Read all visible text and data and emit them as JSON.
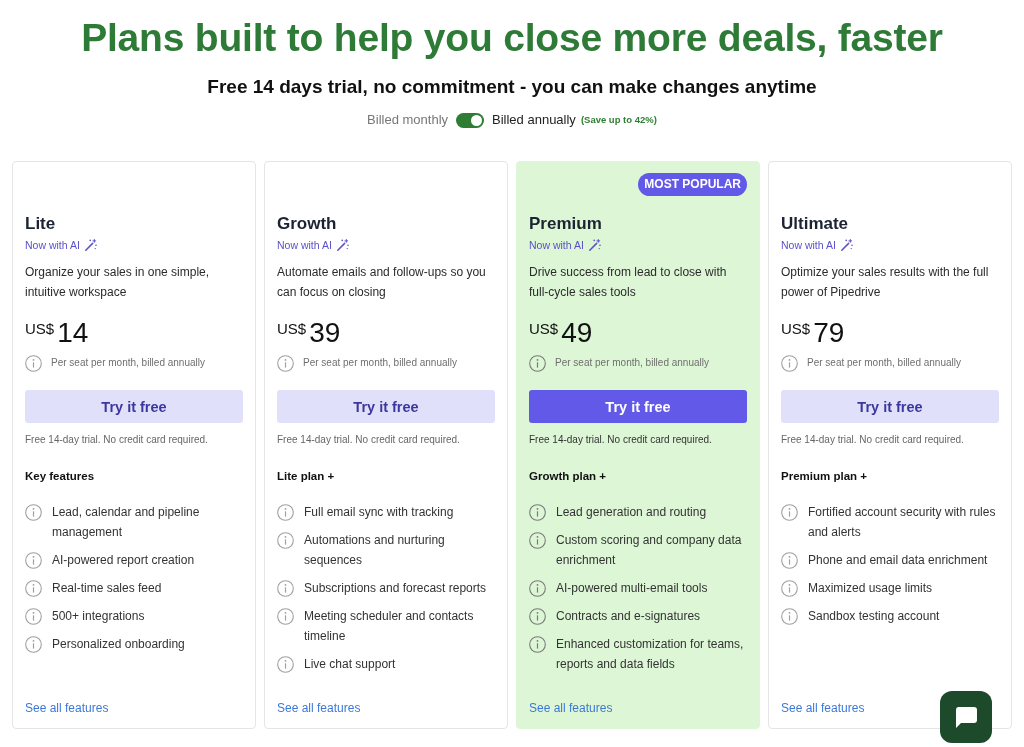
{
  "heading": "Plans built to help you close more deals, faster",
  "subheading": "Free 14 days trial, no commitment - you can make changes anytime",
  "billing_toggle": {
    "left_label": "Billed monthly",
    "right_label": "Billed annually",
    "on": true,
    "savings": "(Save up to 42%)"
  },
  "plans": [
    {
      "name": "Lite",
      "highlighted": false,
      "ai_label": "Now with AI",
      "description": "Organize your sales in one simple, intuitive workspace",
      "currency": "US$",
      "price": "14",
      "price_note": "Per seat per month, billed annually",
      "button_label": "Try it free",
      "trial_note": "Free 14-day trial. No credit card required.",
      "features_heading": "Key features",
      "features": [
        "Lead, calendar and pipeline management",
        "AI-powered report creation",
        "Real-time sales feed",
        "500+ integrations",
        "Personalized onboarding"
      ],
      "link_label": "See all features"
    },
    {
      "name": "Growth",
      "highlighted": false,
      "ai_label": "Now with AI",
      "description": "Automate emails and follow-ups so you can focus on closing",
      "currency": "US$",
      "price": "39",
      "price_note": "Per seat per month, billed annually",
      "button_label": "Try it free",
      "trial_note": "Free 14-day trial. No credit card required.",
      "features_heading": "Lite plan +",
      "features": [
        "Full email sync with tracking",
        "Automations and nurturing sequences",
        "Subscriptions and forecast reports",
        "Meeting scheduler and contacts timeline",
        "Live chat support"
      ],
      "link_label": "See all features"
    },
    {
      "name": "Premium",
      "highlighted": true,
      "badge": "MOST POPULAR",
      "ai_label": "Now with AI",
      "description": "Drive success from lead to close with full-cycle sales tools",
      "currency": "US$",
      "price": "49",
      "price_note": "Per seat per month, billed annually",
      "button_label": "Try it free",
      "trial_note": "Free 14-day trial. No credit card required.",
      "features_heading": "Growth plan +",
      "features": [
        "Lead generation and routing",
        "Custom scoring and company data enrichment",
        "AI-powered multi-email tools",
        "Contracts and e-signatures",
        "Enhanced customization for teams, reports and data fields"
      ],
      "link_label": "See all features"
    },
    {
      "name": "Ultimate",
      "highlighted": false,
      "ai_label": "Now with AI",
      "description": "Optimize your sales results with the full power of Pipedrive",
      "currency": "US$",
      "price": "79",
      "price_note": "Per seat per month, billed annually",
      "button_label": "Try it free",
      "trial_note": "Free 14-day trial. No credit card required.",
      "features_heading": "Premium plan +",
      "features": [
        "Fortified account security with rules and alerts",
        "Phone and email data enrichment",
        "Maximized usage limits",
        "Sandbox testing account"
      ],
      "link_label": "See all features"
    }
  ]
}
